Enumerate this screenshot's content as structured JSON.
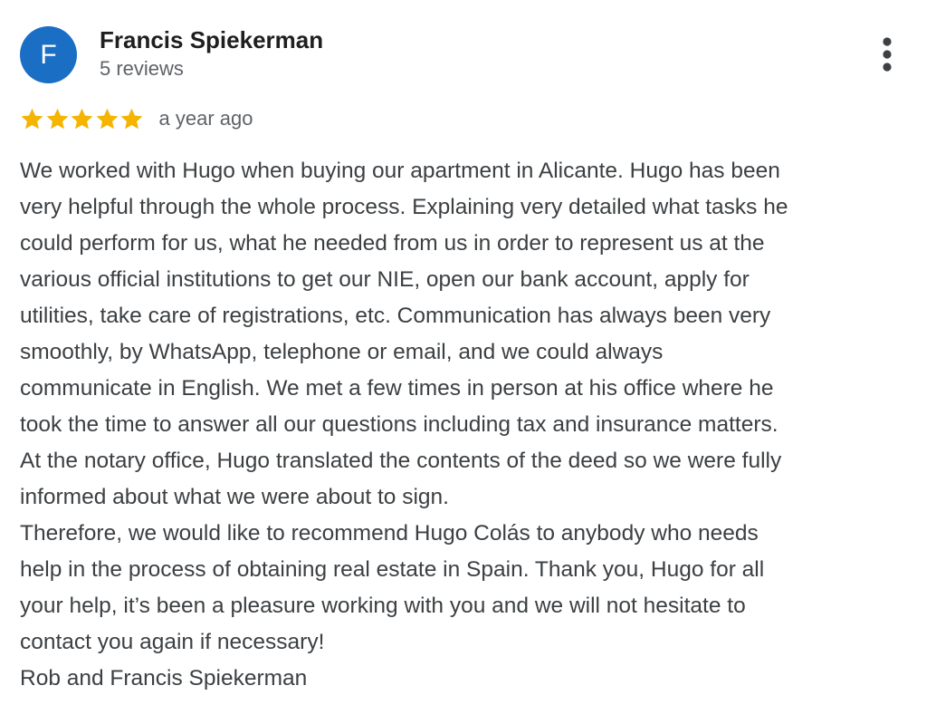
{
  "reviewer": {
    "avatar_letter": "F",
    "avatar_color": "#1a6ec4",
    "name": "Francis Spiekerman",
    "review_count": "5 reviews"
  },
  "menu": {
    "icon": "more-vert-icon"
  },
  "rating": {
    "stars": 5,
    "max_stars": 5,
    "star_color": "#f5b400",
    "date": "a year ago"
  },
  "review": {
    "lines": [
      "We worked with Hugo when buying our apartment in Alicante. Hugo has been",
      "very helpful through the whole process. Explaining very detailed what tasks he",
      "could perform for us, what he needed from us in order to represent us at the",
      "various official institutions to get our NIE, open our bank account, apply for",
      "utilities, take care of registrations, etc. Communication has always been very",
      "smoothly, by WhatsApp, telephone or email, and we could always",
      "communicate in English. We met a few times in person at his office where he",
      "took the time to answer all our questions including tax and insurance matters.",
      "At the notary office, Hugo translated the contents of the deed so we were fully",
      "informed about what we were about to sign.",
      "Therefore, we would like to recommend Hugo Colás to anybody who needs",
      "help in the process of obtaining real estate in Spain. Thank you, Hugo for all",
      "your help, it’s been a pleasure working with you and we will not hesitate to",
      "contact you again if necessary!",
      "Rob and Francis Spiekerman"
    ]
  }
}
